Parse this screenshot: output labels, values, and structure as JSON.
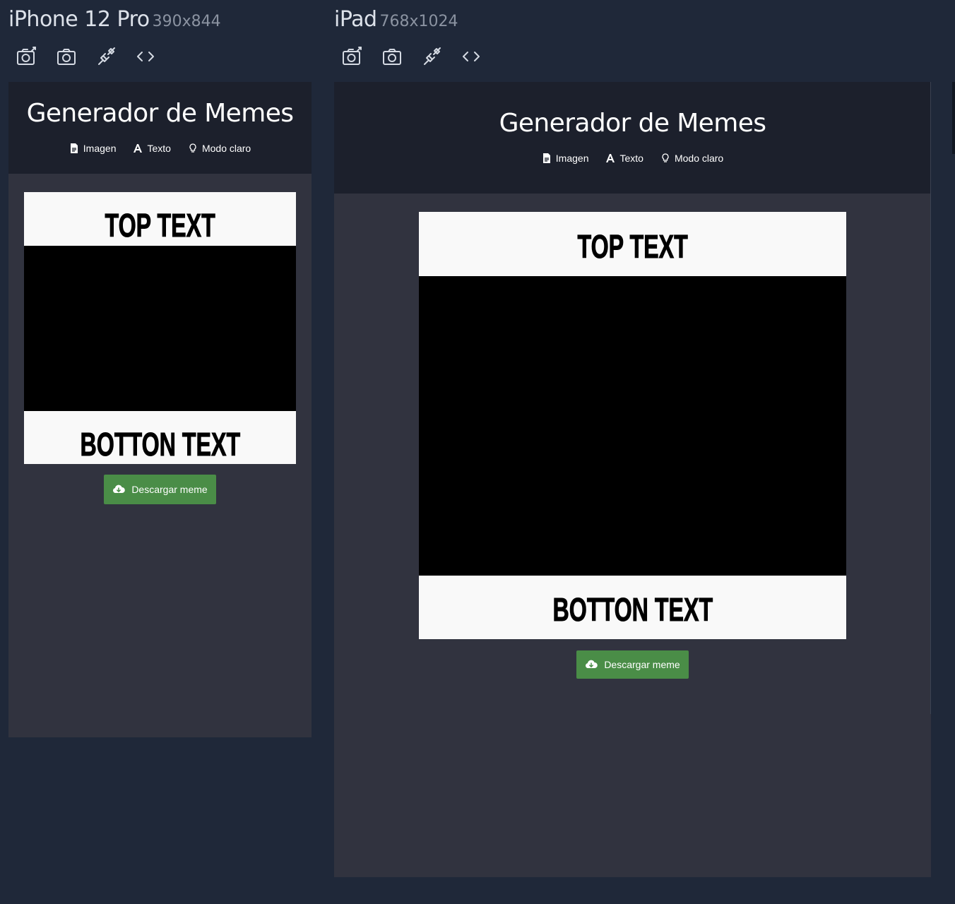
{
  "devices": [
    {
      "name": "iPhone 12 Pro",
      "size": "390x844",
      "toolbar": {
        "screenshot_icon": "camera-edit-icon",
        "camera_icon": "camera-icon",
        "unplug_icon": "plug-icon",
        "code_icon": "code-icon"
      }
    },
    {
      "name": "iPad",
      "size": "768x1024",
      "toolbar": {
        "screenshot_icon": "camera-edit-icon",
        "camera_icon": "camera-icon",
        "unplug_icon": "plug-icon",
        "code_icon": "code-icon"
      }
    }
  ],
  "app": {
    "title": "Generador de Memes",
    "nav": {
      "image": "Imagen",
      "text": "Texto",
      "light_mode": "Modo claro"
    },
    "meme": {
      "top_text": "TOP TEXT",
      "bottom_text": "BOTTON TEXT"
    },
    "download_label": "Descargar meme"
  },
  "colors": {
    "page_bg": "#1f2839",
    "app_header_bg": "#1c202c",
    "app_body_bg": "#31333f",
    "meme_band_bg": "#f9f9f9",
    "meme_image_bg": "#000000",
    "download_button": "#4a8d47"
  }
}
